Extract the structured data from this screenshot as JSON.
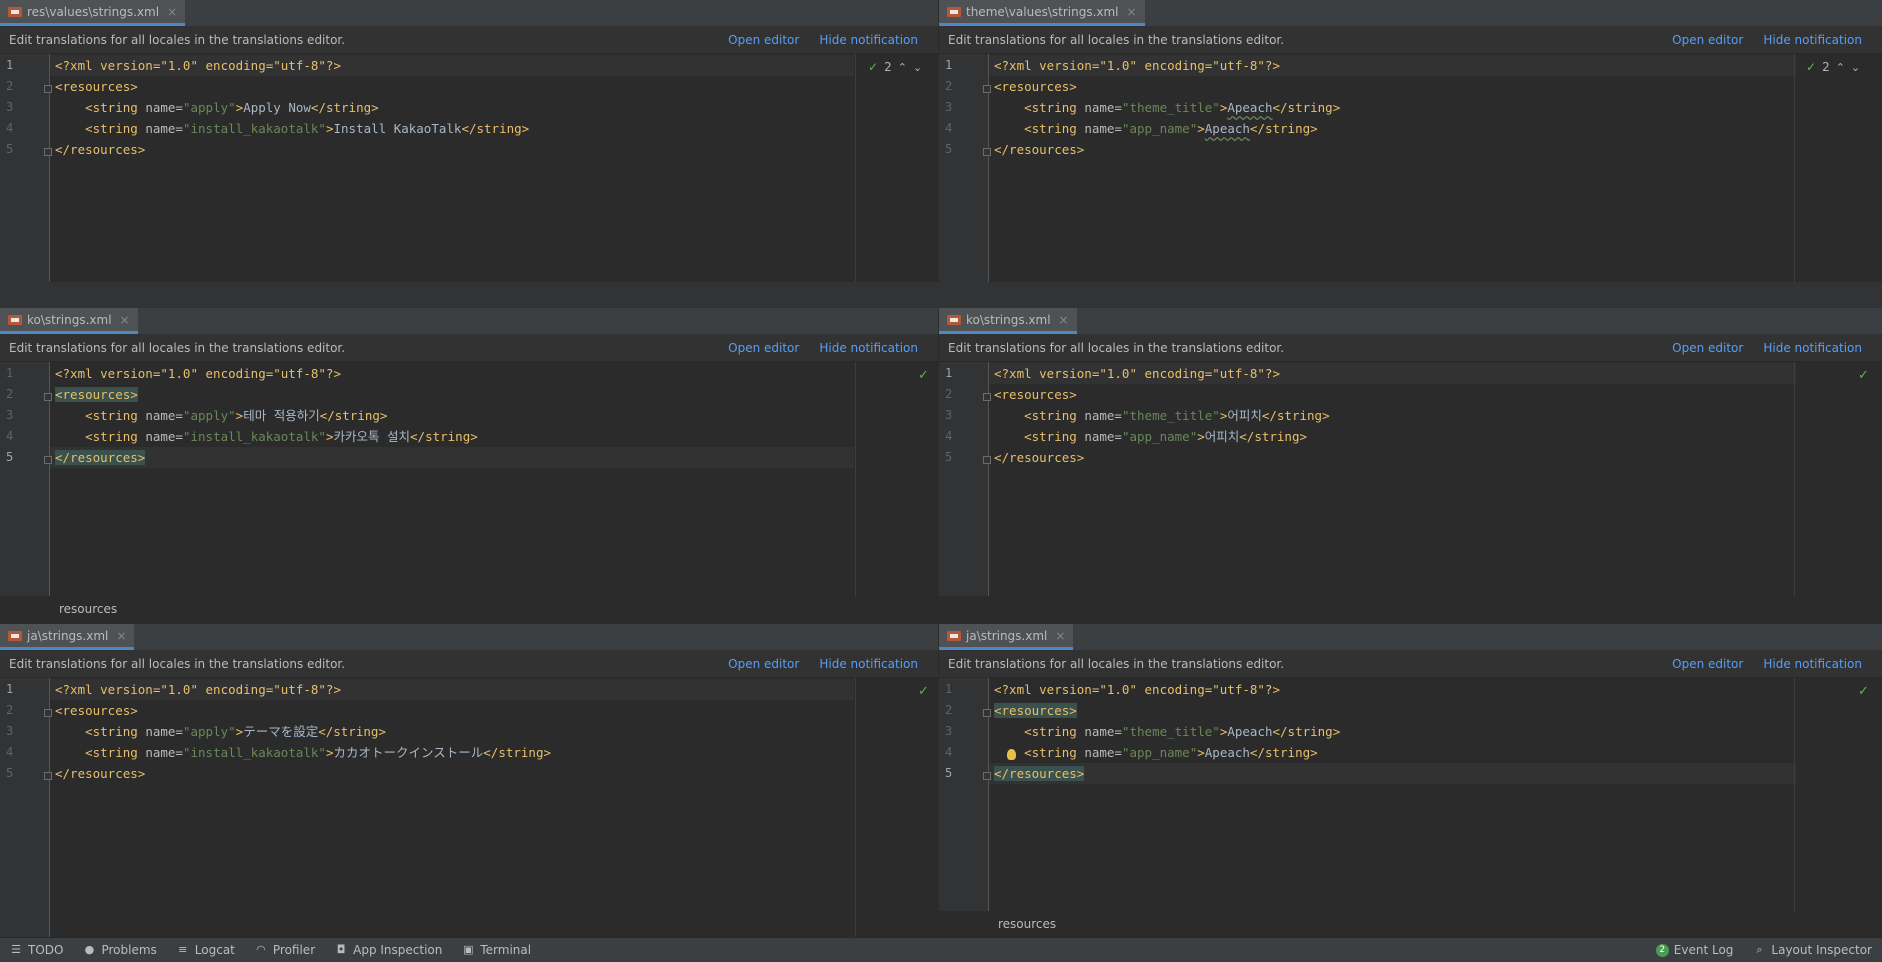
{
  "notification": {
    "message": "Edit translations for all locales in the translations editor.",
    "open_editor": "Open editor",
    "hide_notification": "Hide notification"
  },
  "panes": [
    {
      "tab": "res\\values\\strings.xml",
      "inspection_count": "2",
      "lines": {
        "n": [
          "1",
          "2",
          "3",
          "4",
          "5"
        ],
        "decl": "<?xml version=\"1.0\" encoding=\"utf-8\"?>",
        "open": "<resources>",
        "close": "</resources>",
        "s1_name": "\"apply\"",
        "s1_value": "Apply Now",
        "s2_name": "\"install_kakaotalk\"",
        "s2_value": "Install KakaoTalk"
      }
    },
    {
      "tab": "theme\\values\\strings.xml",
      "inspection_count": "2",
      "lines": {
        "n": [
          "1",
          "2",
          "3",
          "4",
          "5"
        ],
        "decl": "<?xml version=\"1.0\" encoding=\"utf-8\"?>",
        "open": "<resources>",
        "close": "</resources>",
        "s1_name": "\"theme_title\"",
        "s1_value": "Apeach",
        "s2_name": "\"app_name\"",
        "s2_value": "Apeach"
      }
    },
    {
      "tab": "ko\\strings.xml",
      "lines": {
        "n": [
          "1",
          "2",
          "3",
          "4",
          "5"
        ],
        "decl": "<?xml version=\"1.0\" encoding=\"utf-8\"?>",
        "open": "<resources>",
        "close": "</resources>",
        "s1_name": "\"apply\"",
        "s1_value": "테마 적용하기",
        "s2_name": "\"install_kakaotalk\"",
        "s2_value": "카카오톡 설치"
      },
      "breadcrumb": "resources"
    },
    {
      "tab": "ko\\strings.xml",
      "lines": {
        "n": [
          "1",
          "2",
          "3",
          "4",
          "5"
        ],
        "decl": "<?xml version=\"1.0\" encoding=\"utf-8\"?>",
        "open": "<resources>",
        "close": "</resources>",
        "s1_name": "\"theme_title\"",
        "s1_value": "어피치",
        "s2_name": "\"app_name\"",
        "s2_value": "어피치"
      }
    },
    {
      "tab": "ja\\strings.xml",
      "lines": {
        "n": [
          "1",
          "2",
          "3",
          "4",
          "5"
        ],
        "decl": "<?xml version=\"1.0\" encoding=\"utf-8\"?>",
        "open": "<resources>",
        "close": "</resources>",
        "s1_name": "\"apply\"",
        "s1_value": "テーマを設定",
        "s2_name": "\"install_kakaotalk\"",
        "s2_value": "カカオトークインストール"
      }
    },
    {
      "tab": "ja\\strings.xml",
      "lines": {
        "n": [
          "1",
          "2",
          "3",
          "4",
          "5"
        ],
        "decl": "<?xml version=\"1.0\" encoding=\"utf-8\"?>",
        "open": "<resources>",
        "close": "</resources>",
        "s1_name": "\"theme_title\"",
        "s1_value": "Apeach",
        "s2_name": "\"app_name\"",
        "s2_value": "Apeach"
      },
      "breadcrumb": "resources"
    }
  ],
  "xml": {
    "string_open": "<string",
    "name_attr": "name=",
    "gt": ">",
    "string_close": "</string>"
  },
  "statusbar": {
    "todo": "TODO",
    "problems": "Problems",
    "logcat": "Logcat",
    "profiler": "Profiler",
    "app_inspection": "App Inspection",
    "terminal": "Terminal",
    "event_log_count": "2",
    "event_log": "Event Log",
    "layout_inspector": "Layout Inspector"
  },
  "colors": {
    "tag": "#e8bf6a",
    "attr_value": "#6a8759",
    "link": "#589df6",
    "check": "#62b543"
  }
}
